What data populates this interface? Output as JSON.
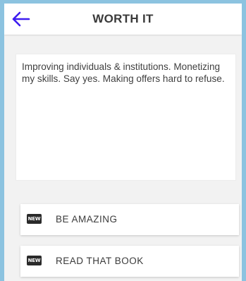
{
  "header": {
    "back_icon": "arrow-left-icon",
    "title": "WORTH IT"
  },
  "note": {
    "text": "Improving individuals & institutions. Monetizing my skills. Say yes. Making offers hard to refuse."
  },
  "items": [
    {
      "badge": "NEW",
      "label": "BE AMAZING"
    },
    {
      "badge": "NEW",
      "label": "READ THAT BOOK"
    }
  ],
  "colors": {
    "accent": "#3d1cf0",
    "frame": "#8cc3e0",
    "background": "#f2f2f2"
  }
}
